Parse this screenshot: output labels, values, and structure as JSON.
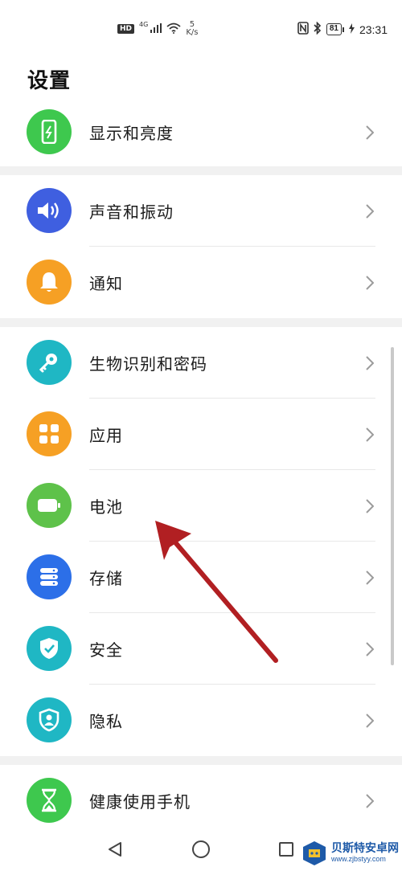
{
  "status_bar": {
    "hd": "HD",
    "network": "4G",
    "speed_value": "5",
    "speed_unit": "K/s",
    "battery_level": "81",
    "time": "23:31"
  },
  "page": {
    "title": "设置"
  },
  "groups": [
    {
      "items": [
        {
          "label": "显示和亮度",
          "icon": "display-brightness-icon",
          "color": "#3ec84e"
        }
      ]
    },
    {
      "items": [
        {
          "label": "声音和振动",
          "icon": "speaker-icon",
          "color": "#3f5fe0"
        },
        {
          "label": "通知",
          "icon": "bell-icon",
          "color": "#f6a024"
        }
      ]
    },
    {
      "items": [
        {
          "label": "生物识别和密码",
          "icon": "key-icon",
          "color": "#1fb7c4"
        },
        {
          "label": "应用",
          "icon": "apps-grid-icon",
          "color": "#f6a024"
        },
        {
          "label": "电池",
          "icon": "battery-icon",
          "color": "#5ec24a"
        },
        {
          "label": "存储",
          "icon": "storage-icon",
          "color": "#2c6fe8"
        },
        {
          "label": "安全",
          "icon": "shield-check-icon",
          "color": "#1fb7c4"
        },
        {
          "label": "隐私",
          "icon": "privacy-shield-icon",
          "color": "#1fb7c4"
        }
      ]
    },
    {
      "items": [
        {
          "label": "健康使用手机",
          "icon": "hourglass-icon",
          "color": "#3ec84e"
        }
      ]
    }
  ],
  "annotation": {
    "arrow_color": "#b11f22"
  },
  "watermark": {
    "main": "贝斯特安卓网",
    "sub": "www.zjbstyy.com"
  }
}
